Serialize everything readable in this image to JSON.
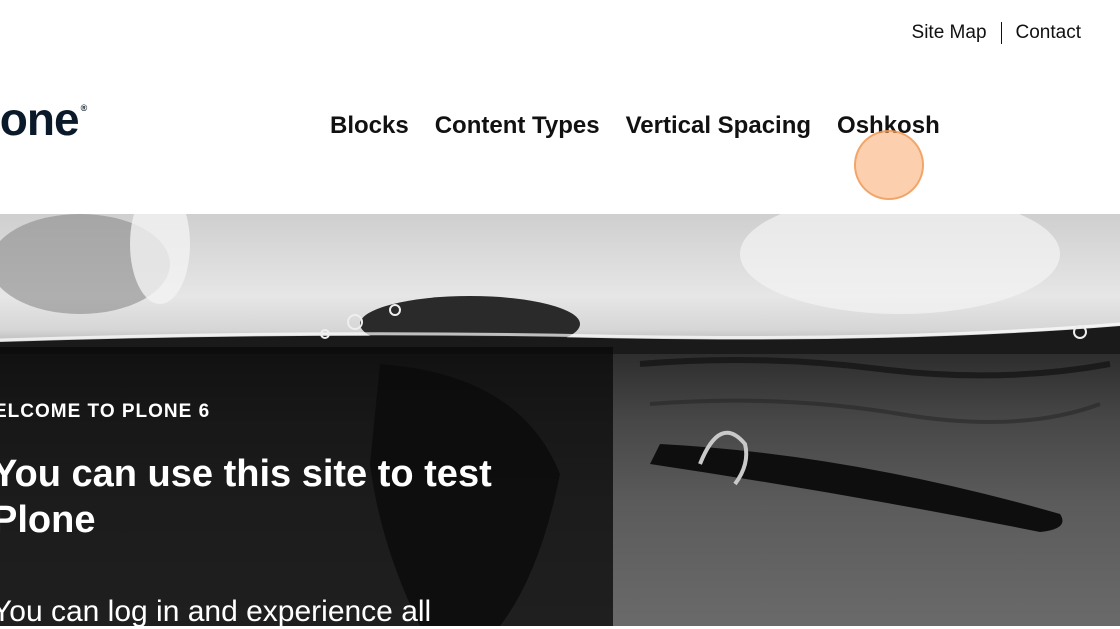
{
  "top_links": {
    "site_map": "Site Map",
    "contact": "Contact"
  },
  "logo": {
    "text": "lone",
    "reg_mark": "®"
  },
  "nav": {
    "items": [
      "Blocks",
      "Content Types",
      "Vertical Spacing",
      "Oshkosh"
    ]
  },
  "hero": {
    "kicker": "ELCOME TO PLONE 6",
    "headline": "You can use this site to test Plone",
    "subtext": "You can log in and experience all"
  },
  "colors": {
    "panel": "#0a0a0a",
    "cursor_highlight": "#faaa6e",
    "logo": "#0b1a2a"
  }
}
